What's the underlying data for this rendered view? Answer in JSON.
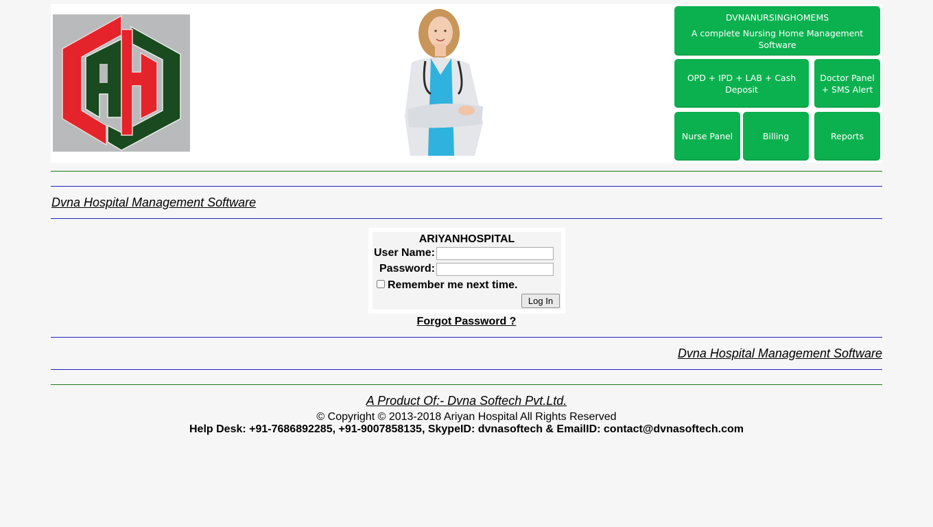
{
  "header": {
    "logo_alt": "AH logo",
    "doctor_image_alt": "Doctor with stethoscope",
    "tiles": {
      "main_title": "DVNANURSINGHOMEMS",
      "main_subtitle": "A complete Nursing Home Management Software",
      "opd": "OPD + IPD +  LAB + Cash Deposit",
      "doctor": "Doctor Panel + SMS Alert",
      "nurse": "Nurse Panel",
      "billing": "Billing",
      "reports": "Reports"
    },
    "colors": {
      "tile_green": "#0bb14f",
      "logo_red": "#e5232a",
      "logo_green": "#1a4a1f"
    }
  },
  "top_link": "Dvna Hospital Management Software",
  "login": {
    "title": "ARIYANHOSPITAL",
    "username_label": "User Name:",
    "username_value": "",
    "password_label": "Password:",
    "password_value": "",
    "remember_label": "Remember me next time.",
    "remember_checked": false,
    "login_button": "Log In"
  },
  "forgot_password": "Forgot Password ?",
  "bottom_link": "Dvna Hospital Management Software",
  "footer": {
    "product": "A Product Of:- Dvna Softech Pvt.Ltd.",
    "copyright": "© Copyright © 2013-2018 Ariyan Hospital All Rights Reserved",
    "helpdesk": "Help Desk: +91-7686892285, +91-9007858135, SkypeID: dvnasoftech & EmailID: contact@dvnasoftech.com"
  }
}
